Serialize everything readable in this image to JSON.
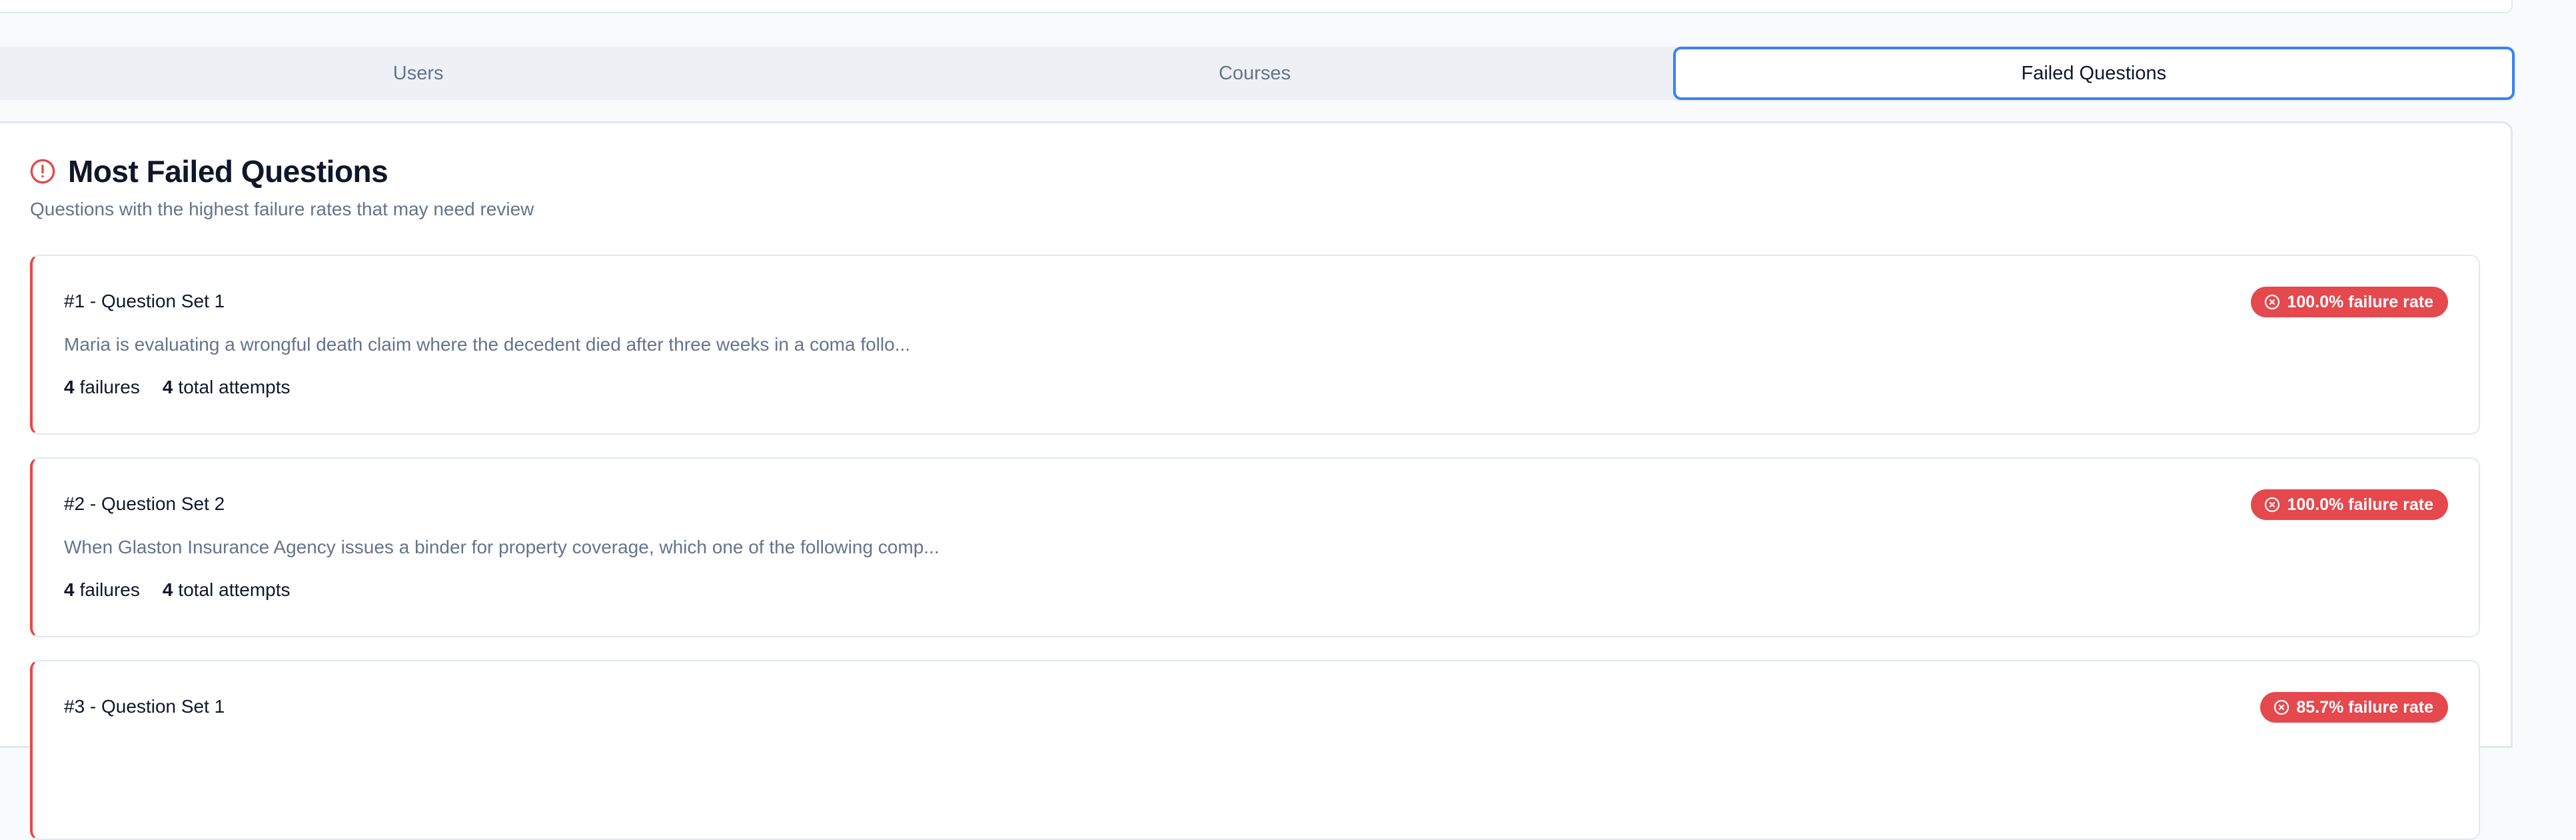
{
  "tabs": [
    {
      "label": "Users",
      "active": false
    },
    {
      "label": "Courses",
      "active": false
    },
    {
      "label": "Failed Questions",
      "active": true
    }
  ],
  "panel": {
    "icon": "alert-circle-icon",
    "title": "Most Failed Questions",
    "subtitle": "Questions with the highest failure rates that may need review"
  },
  "questions": [
    {
      "title": "#1 - Question Set 1",
      "text": "Maria is evaluating a wrongful death claim where the decedent died after three weeks in a coma follo...",
      "failures_count": "4",
      "failures_label": "failures",
      "attempts_count": "4",
      "attempts_label": "total attempts",
      "badge": "100.0% failure rate",
      "badge_icon": "x-circle-icon"
    },
    {
      "title": "#2 - Question Set 2",
      "text": "When Glaston Insurance Agency issues a binder for property coverage, which one of the following comp...",
      "failures_count": "4",
      "failures_label": "failures",
      "attempts_count": "4",
      "attempts_label": "total attempts",
      "badge": "100.0% failure rate",
      "badge_icon": "x-circle-icon"
    },
    {
      "title": "#3 - Question Set 1",
      "badge": "85.7% failure rate",
      "badge_icon": "x-circle-icon"
    }
  ],
  "colors": {
    "accent_blue": "#3b82f6",
    "danger_red": "#e5484d",
    "muted_text": "#64748b",
    "dark_text": "#0f172a"
  }
}
